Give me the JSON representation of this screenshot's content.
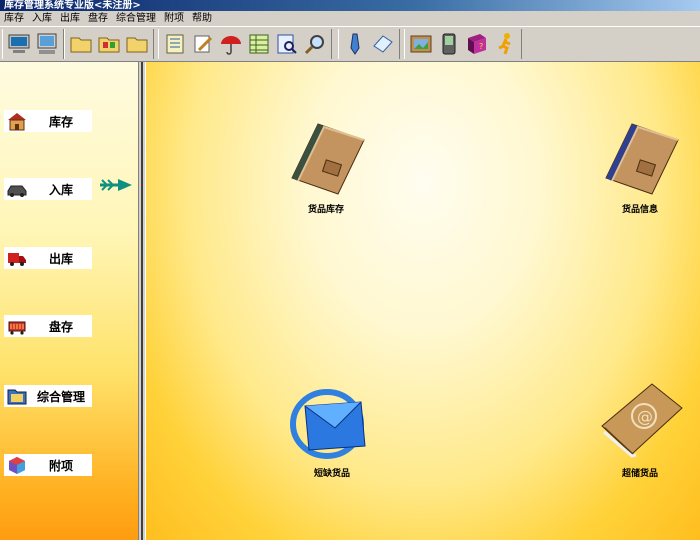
{
  "window": {
    "title": "库存管理系统专业版<未注册>"
  },
  "menu": {
    "items": [
      "库存",
      "入库",
      "出库",
      "盘存",
      "综合管理",
      "附项",
      "帮助"
    ]
  },
  "toolbar": {
    "groups": [
      [
        "computer-icon",
        "monitor-icon"
      ],
      [
        "folder-icon",
        "network-folder-icon",
        "folder-icon"
      ],
      [
        "scroll-list-icon",
        "edit-note-icon",
        "umbrella-icon",
        "spreadsheet-icon",
        "search-document-icon",
        "magnifier-icon"
      ],
      [
        "pen-icon",
        "notepad-icon"
      ],
      [
        "picture-icon",
        "handheld-icon",
        "help-book-icon",
        "running-man-icon"
      ]
    ]
  },
  "sidebar": {
    "items": [
      {
        "label": "库存",
        "icon": "house-icon"
      },
      {
        "label": "入库",
        "icon": "car-icon"
      },
      {
        "label": "出库",
        "icon": "truck-icon"
      },
      {
        "label": "盘存",
        "icon": "cart-icon"
      },
      {
        "label": "综合管理",
        "icon": "folder-grid-icon"
      },
      {
        "label": "附项",
        "icon": "cube-icon"
      }
    ],
    "pointer_icon": "arrow-right-icon"
  },
  "main": {
    "items": [
      {
        "label": "货品库存",
        "icon": "brown-book-icon"
      },
      {
        "label": "货品信息",
        "icon": "blue-book-icon"
      },
      {
        "label": "短缺货品",
        "icon": "mail-icon"
      },
      {
        "label": "超储货品",
        "icon": "at-book-icon"
      }
    ]
  },
  "colors": {
    "title_bar": "#0a246a",
    "sidebar_bottom": "#ff9c10",
    "main_center": "#fff8d0",
    "main_edge": "#ffbe1e"
  }
}
